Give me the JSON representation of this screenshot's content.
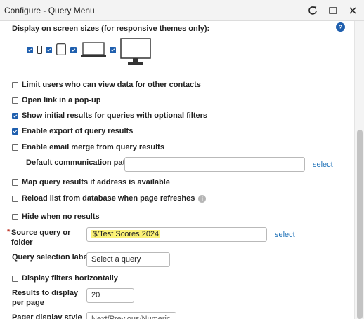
{
  "window": {
    "title": "Configure - Query Menu"
  },
  "screen_sizes": {
    "label": "Display on screen sizes (for responsive themes only):",
    "devices": [
      {
        "name": "mobile",
        "checked": true
      },
      {
        "name": "tablet-portrait",
        "checked": true
      },
      {
        "name": "laptop",
        "checked": true
      },
      {
        "name": "desktop",
        "checked": true
      }
    ]
  },
  "options": {
    "limit_users": {
      "label": "Limit users who can view data for other contacts",
      "checked": false
    },
    "open_popup": {
      "label": "Open link in a pop-up",
      "checked": false
    },
    "show_initial": {
      "label": "Show initial results for queries with optional filters",
      "checked": true
    },
    "enable_export": {
      "label": "Enable export of query results",
      "checked": true
    },
    "enable_email_merge": {
      "label": "Enable email merge from query results",
      "checked": false
    },
    "default_comm_path": {
      "label": "Default communication path",
      "value": "",
      "link": "select"
    },
    "map_results": {
      "label": "Map query results if address is available",
      "checked": false
    },
    "reload_list": {
      "label": "Reload list from database when page refreshes",
      "checked": false
    },
    "hide_no_results": {
      "label": "Hide when no results",
      "checked": false
    }
  },
  "source_query": {
    "required_mark": "*",
    "label": "Source query or folder",
    "value": "$/Test Scores 2024",
    "link": "select"
  },
  "query_selection": {
    "label": "Query selection label",
    "value": "Select a query"
  },
  "display_filters": {
    "label": "Display filters horizontally",
    "checked": false
  },
  "results_per_page": {
    "label": "Results to display per page",
    "value": "20"
  },
  "pager_style": {
    "label": "Pager display style",
    "value": "Next/Previous/Numeric"
  },
  "colors": {
    "accent": "#1f5fae",
    "link": "#1f72b8",
    "highlight": "#fbf277",
    "required": "#c0392b"
  }
}
